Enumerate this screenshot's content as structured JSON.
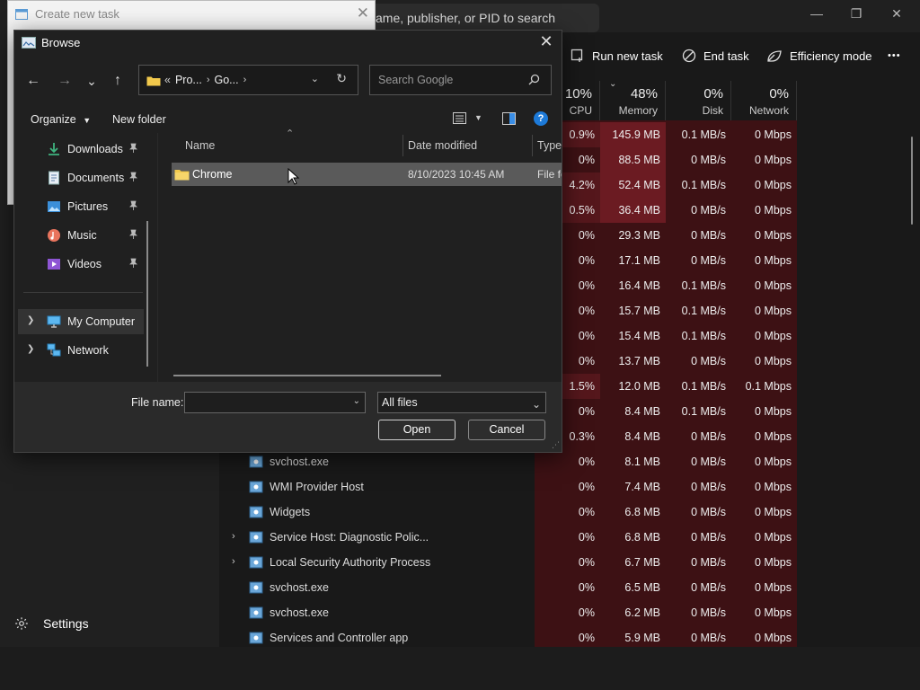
{
  "task_manager": {
    "search_placeholder": "ame, publisher, or PID to search",
    "window_controls": {
      "minimize": "—",
      "maximize": "❐",
      "close": "✕"
    },
    "toolbar": {
      "run_new_task": "Run new task",
      "end_task": "End task",
      "efficiency_mode": "Efficiency mode",
      "more": "•••"
    },
    "columns": [
      {
        "pct": "10%",
        "name": "CPU"
      },
      {
        "pct": "48%",
        "name": "Memory"
      },
      {
        "pct": "0%",
        "name": "Disk"
      },
      {
        "pct": "0%",
        "name": "Network"
      }
    ],
    "settings_label": "Settings",
    "rows": [
      {
        "name": "",
        "cpu": "0.9%",
        "mem": "145.9 MB",
        "disk": "0.1 MB/s",
        "net": "0 Mbps"
      },
      {
        "name": "",
        "cpu": "0%",
        "mem": "88.5 MB",
        "disk": "0 MB/s",
        "net": "0 Mbps"
      },
      {
        "name": "",
        "cpu": "4.2%",
        "mem": "52.4 MB",
        "disk": "0.1 MB/s",
        "net": "0 Mbps"
      },
      {
        "name": "",
        "cpu": "0.5%",
        "mem": "36.4 MB",
        "disk": "0 MB/s",
        "net": "0 Mbps"
      },
      {
        "name": "",
        "cpu": "0%",
        "mem": "29.3 MB",
        "disk": "0 MB/s",
        "net": "0 Mbps"
      },
      {
        "name": "",
        "cpu": "0%",
        "mem": "17.1 MB",
        "disk": "0 MB/s",
        "net": "0 Mbps"
      },
      {
        "name": "",
        "cpu": "0%",
        "mem": "16.4 MB",
        "disk": "0.1 MB/s",
        "net": "0 Mbps"
      },
      {
        "name": "",
        "cpu": "0%",
        "mem": "15.7 MB",
        "disk": "0.1 MB/s",
        "net": "0 Mbps"
      },
      {
        "name": "",
        "cpu": "0%",
        "mem": "15.4 MB",
        "disk": "0.1 MB/s",
        "net": "0 Mbps"
      },
      {
        "name": "",
        "cpu": "0%",
        "mem": "13.7 MB",
        "disk": "0 MB/s",
        "net": "0 Mbps"
      },
      {
        "name": "",
        "cpu": "1.5%",
        "mem": "12.0 MB",
        "disk": "0.1 MB/s",
        "net": "0.1 Mbps"
      },
      {
        "name": "",
        "cpu": "0%",
        "mem": "8.4 MB",
        "disk": "0.1 MB/s",
        "net": "0 Mbps"
      },
      {
        "name": "",
        "cpu": "0.3%",
        "mem": "8.4 MB",
        "disk": "0 MB/s",
        "net": "0 Mbps"
      },
      {
        "name": "svchost.exe",
        "cpu": "0%",
        "mem": "8.1 MB",
        "disk": "0 MB/s",
        "net": "0 Mbps"
      },
      {
        "name": "WMI Provider Host",
        "cpu": "0%",
        "mem": "7.4 MB",
        "disk": "0 MB/s",
        "net": "0 Mbps"
      },
      {
        "name": "Widgets",
        "cpu": "0%",
        "mem": "6.8 MB",
        "disk": "0 MB/s",
        "net": "0 Mbps"
      },
      {
        "name": "Service Host: Diagnostic Polic...",
        "cpu": "0%",
        "mem": "6.8 MB",
        "disk": "0 MB/s",
        "net": "0 Mbps",
        "expandable": true
      },
      {
        "name": "Local Security Authority Process",
        "cpu": "0%",
        "mem": "6.7 MB",
        "disk": "0 MB/s",
        "net": "0 Mbps",
        "expandable": true
      },
      {
        "name": "svchost.exe",
        "cpu": "0%",
        "mem": "6.5 MB",
        "disk": "0 MB/s",
        "net": "0 Mbps"
      },
      {
        "name": "svchost.exe",
        "cpu": "0%",
        "mem": "6.2 MB",
        "disk": "0 MB/s",
        "net": "0 Mbps"
      },
      {
        "name": "Services and Controller app",
        "cpu": "0%",
        "mem": "5.9 MB",
        "disk": "0 MB/s",
        "net": "0 Mbps"
      }
    ]
  },
  "create_task_dialog": {
    "title": "Create new task",
    "close": "✕"
  },
  "browse_dialog": {
    "title": "Browse",
    "close": "✕",
    "nav": {
      "back": "←",
      "forward": "→",
      "recent": "⌄",
      "up": "↑"
    },
    "address": {
      "overflow": "«",
      "crumbs": [
        "Pro...",
        "Go..."
      ],
      "sep": "›"
    },
    "search_placeholder": "Search Google",
    "cmd": {
      "organize": "Organize",
      "new_folder": "New folder",
      "help": "?"
    },
    "nav_pane": [
      {
        "label": "Downloads",
        "icon": "download-icon",
        "pinned": true
      },
      {
        "label": "Documents",
        "icon": "documents-icon",
        "pinned": true
      },
      {
        "label": "Pictures",
        "icon": "pictures-icon",
        "pinned": true
      },
      {
        "label": "Music",
        "icon": "music-icon",
        "pinned": true
      },
      {
        "label": "Videos",
        "icon": "videos-icon",
        "pinned": true
      },
      {
        "label": "My Computer",
        "icon": "computer-icon",
        "expandable": true,
        "selected": true
      },
      {
        "label": "Network",
        "icon": "network-icon",
        "expandable": true
      }
    ],
    "columns": {
      "name": "Name",
      "date": "Date modified",
      "type": "Type"
    },
    "files": [
      {
        "name": "Chrome",
        "date": "8/10/2023 10:45 AM",
        "type": "File folder"
      }
    ],
    "file_name_label": "File name:",
    "file_name_value": "",
    "filter_value": "All files",
    "open_label": "Open",
    "cancel_label": "Cancel"
  },
  "colors": {
    "heat": "#3d1114",
    "heat_strong": "#6b1b22",
    "accent": "#1d7ad8",
    "folder": "#f2c94c"
  }
}
